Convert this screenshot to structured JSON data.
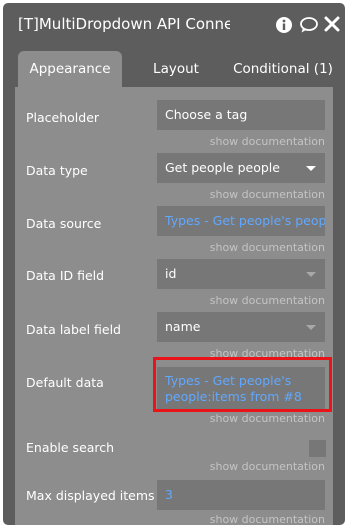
{
  "window": {
    "title": "[T]MultiDropdown API Connector",
    "icons": [
      "info-icon",
      "comment-icon",
      "close-icon"
    ]
  },
  "tabs": [
    {
      "label": "Appearance",
      "active": true
    },
    {
      "label": "Layout",
      "active": false
    },
    {
      "label": "Conditional (1)",
      "active": false
    }
  ],
  "doc_link": "show documentation",
  "fields": {
    "placeholder": {
      "label": "Placeholder",
      "value": "Choose a tag"
    },
    "data_type": {
      "label": "Data type",
      "value": "Get people people"
    },
    "data_source": {
      "label": "Data source",
      "value": "Types - Get people's people"
    },
    "data_id_field": {
      "label": "Data ID field",
      "value": "id"
    },
    "data_label_field": {
      "label": "Data label field",
      "value": "name"
    },
    "default_data": {
      "label": "Default data",
      "line1": "Types - Get people's",
      "line2": "people:items from #8"
    },
    "enable_search": {
      "label": "Enable search",
      "checked": false
    },
    "max_displayed_items": {
      "label": "Max displayed items",
      "value": "3"
    }
  },
  "colors": {
    "panel_bg": "#5d5d5d",
    "content_bg": "#8d8d8d",
    "field_bg": "#777777",
    "dynamic_text": "#61a8ff",
    "highlight": "#e8141a"
  }
}
